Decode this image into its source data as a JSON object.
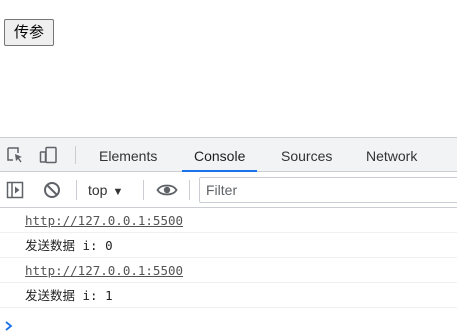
{
  "page": {
    "button_label": "传参"
  },
  "devtools": {
    "tabs": [
      {
        "label": "Elements"
      },
      {
        "label": "Console"
      },
      {
        "label": "Sources"
      },
      {
        "label": "Network"
      }
    ],
    "active_tab": "Console",
    "icons": {
      "inspect": "inspect-element-icon",
      "device": "device-toolbar-icon",
      "sidebar": "show-sidebar-icon",
      "clear": "clear-console-icon",
      "eye": "live-expression-icon",
      "prompt": "console-prompt-icon"
    },
    "context_selector": "top",
    "filter_placeholder": "Filter",
    "accent_color": "#1a73e8",
    "messages": [
      {
        "text": "http://127.0.0.1:5500",
        "is_link": true
      },
      {
        "text": "发送数据 i: 0",
        "is_link": false
      },
      {
        "text": "http://127.0.0.1:5500",
        "is_link": true
      },
      {
        "text": "发送数据 i: 1",
        "is_link": false
      }
    ]
  }
}
